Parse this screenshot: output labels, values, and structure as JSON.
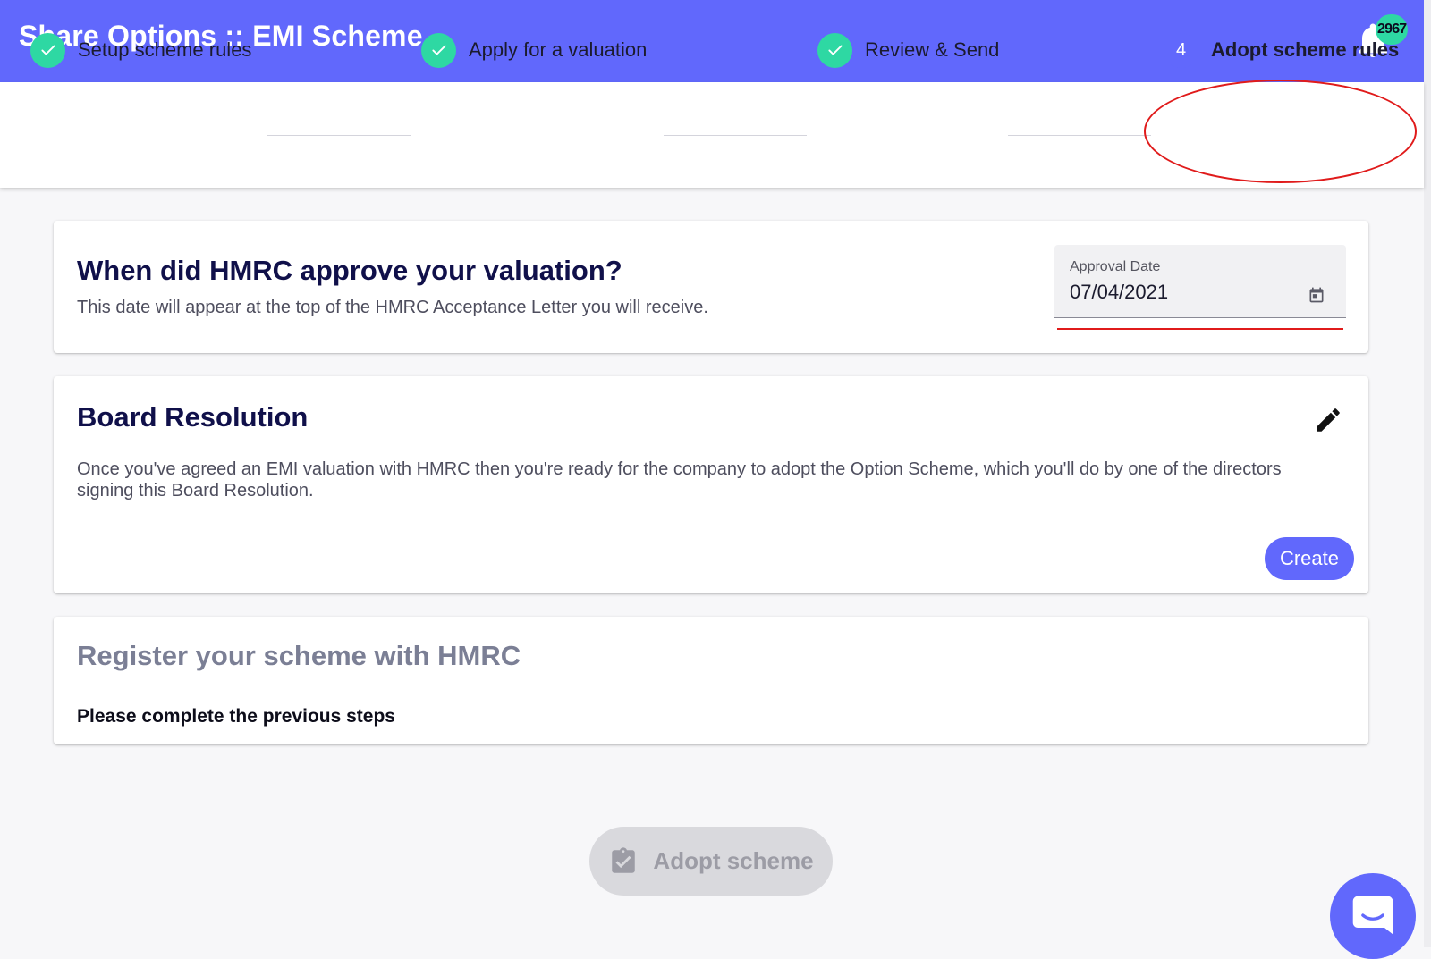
{
  "header": {
    "title": "Share Options :: EMI Scheme",
    "notification_count": "2967"
  },
  "stepper": {
    "steps": [
      {
        "label": "Setup scheme rules",
        "state": "done"
      },
      {
        "label": "Apply for a valuation",
        "state": "done"
      },
      {
        "label": "Review & Send",
        "state": "done"
      },
      {
        "label": "Adopt scheme rules",
        "state": "active",
        "number": "4"
      }
    ]
  },
  "approval": {
    "title": "When did HMRC approve your valuation?",
    "subtitle": "This date will appear at the top of the HMRC Acceptance Letter you will receive.",
    "field_label": "Approval Date",
    "field_value": "07/04/2021"
  },
  "board": {
    "title": "Board Resolution",
    "description": "Once you've agreed an EMI valuation with HMRC then you're ready for the company to adopt the Option Scheme, which you'll do by one of the directors signing this Board Resolution.",
    "create_label": "Create"
  },
  "register": {
    "title": "Register your scheme with HMRC",
    "note": "Please complete the previous steps"
  },
  "footer": {
    "adopt_label": "Adopt scheme"
  },
  "colors": {
    "brand": "#6168fc",
    "success": "#2ed8a3",
    "annotation": "#e01b1b"
  },
  "icons": [
    "bell-icon",
    "check-icon",
    "calendar-icon",
    "pencil-icon",
    "clipboard-check-icon",
    "chat-icon"
  ]
}
